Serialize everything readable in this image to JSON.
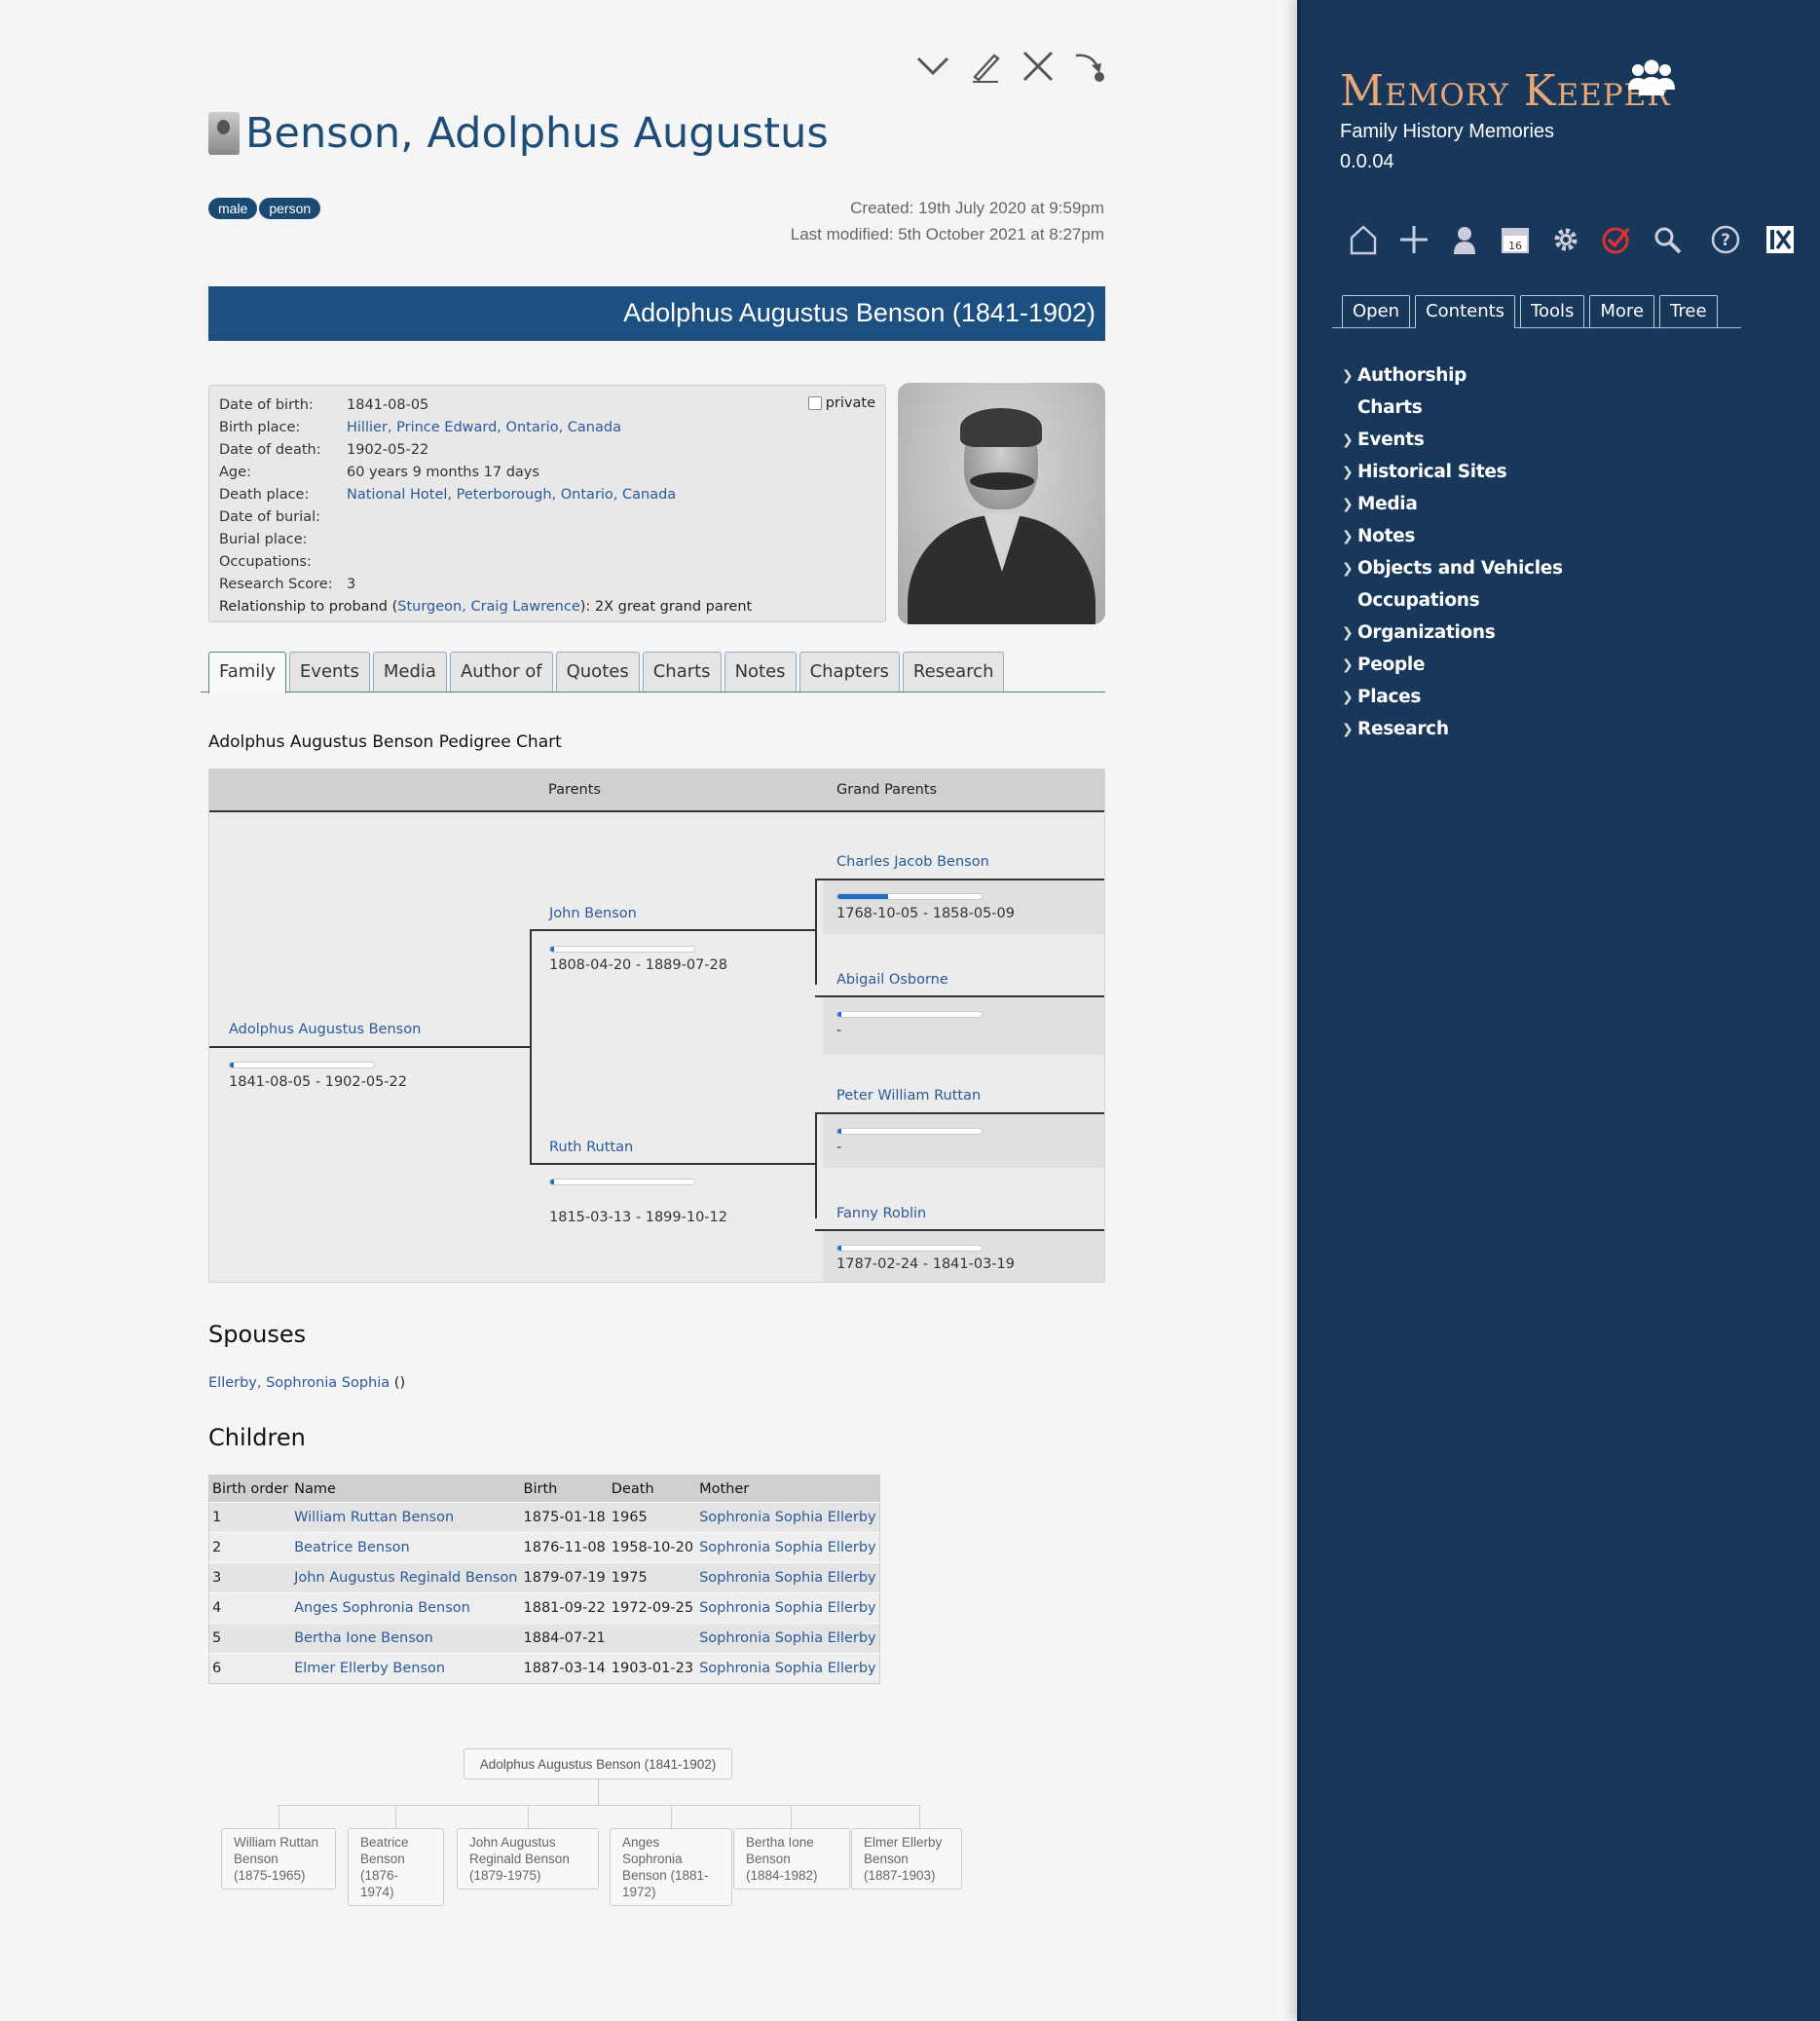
{
  "page": {
    "title": "Benson, Adolphus Augustus",
    "tags": [
      "male",
      "person"
    ],
    "created": "Created: 19th July 2020 at 9:59pm",
    "modified": "Last modified: 5th October 2021 at 8:27pm",
    "banner": "Adolphus Augustus Benson (1841-1902)"
  },
  "toolbar_icons": [
    "chevron-down-icon",
    "edit-icon",
    "close-icon",
    "export-icon"
  ],
  "facts": [
    {
      "label": "Date of birth:",
      "value": "1841-08-05",
      "link": false
    },
    {
      "label": "Birth place:",
      "value": "Hillier, Prince Edward, Ontario, Canada",
      "link": true
    },
    {
      "label": "Date of death:",
      "value": "1902-05-22",
      "link": false
    },
    {
      "label": "Age:",
      "value": "60 years 9 months 17 days",
      "link": false
    },
    {
      "label": "Death place:",
      "value": "National Hotel, Peterborough, Ontario, Canada",
      "link": true
    },
    {
      "label": "Date of burial:",
      "value": "",
      "link": false
    },
    {
      "label": "Burial place:",
      "value": "",
      "link": false
    },
    {
      "label": "Occupations:",
      "value": "",
      "link": false
    },
    {
      "label": "Research Score:",
      "value": "3",
      "link": false
    }
  ],
  "relationship": {
    "prefix": "Relationship to proband (",
    "link": "Sturgeon, Craig Lawrence",
    "suffix": "): 2X great grand parent"
  },
  "private_label": "private",
  "tabs": [
    "Family",
    "Events",
    "Media",
    "Author of",
    "Quotes",
    "Charts",
    "Notes",
    "Chapters",
    "Research"
  ],
  "pedigree": {
    "title": "Adolphus Augustus Benson Pedigree Chart",
    "col_parents": "Parents",
    "col_grandparents": "Grand Parents",
    "self": {
      "name": "Adolphus Augustus Benson",
      "dates": "1841-08-05 - 1902-05-22",
      "score": 0.03
    },
    "father": {
      "name": "John Benson",
      "dates": "1808-04-20 - 1889-07-28",
      "score": 0.03
    },
    "mother": {
      "name": "Ruth Ruttan",
      "dates": "1815-03-13 - 1899-10-12",
      "score": 0.03
    },
    "pgf": {
      "name": "Charles Jacob Benson",
      "dates": "1768-10-05 - 1858-05-09",
      "score": 0.35
    },
    "pgm": {
      "name": "Abigail Osborne",
      "dates": "-",
      "score": 0.03
    },
    "mgf": {
      "name": "Peter William Ruttan",
      "dates": "-",
      "score": 0.03
    },
    "mgm": {
      "name": "Fanny Roblin",
      "dates": "1787-02-24 - 1841-03-19",
      "score": 0.03
    }
  },
  "spouses": {
    "heading": "Spouses",
    "items": [
      {
        "name": "Ellerby, Sophronia Sophia",
        "suffix": " ()"
      }
    ]
  },
  "children": {
    "heading": "Children",
    "columns": [
      "Birth order",
      "Name",
      "Birth",
      "Death",
      "Mother"
    ],
    "rows": [
      [
        "1",
        "William Ruttan Benson",
        "1875-01-18",
        "1965",
        "Sophronia Sophia Ellerby"
      ],
      [
        "2",
        "Beatrice Benson",
        "1876-11-08",
        "1958-10-20",
        "Sophronia Sophia Ellerby"
      ],
      [
        "3",
        "John Augustus Reginald Benson",
        "1879-07-19",
        "1975",
        "Sophronia Sophia Ellerby"
      ],
      [
        "4",
        "Anges Sophronia Benson",
        "1881-09-22",
        "1972-09-25",
        "Sophronia Sophia Ellerby"
      ],
      [
        "5",
        "Bertha Ione Benson",
        "1884-07-21",
        "",
        "Sophronia Sophia Ellerby"
      ],
      [
        "6",
        "Elmer Ellerby Benson",
        "1887-03-14",
        "1903-01-23",
        "Sophronia Sophia Ellerby"
      ]
    ]
  },
  "tree": {
    "root": "Adolphus Augustus Benson (1841-1902)",
    "nodes": [
      [
        "William Ruttan",
        "Benson",
        "(1875-1965)"
      ],
      [
        "Beatrice",
        "Benson",
        "(1876-",
        "1974)"
      ],
      [
        "John Augustus",
        "Reginald Benson",
        "(1879-1975)"
      ],
      [
        "Anges",
        "Sophronia",
        "Benson (1881-",
        "1972)"
      ],
      [
        "Bertha Ione",
        "Benson",
        "(1884-1982)"
      ],
      [
        "Elmer Ellerby",
        "Benson",
        "(1887-1903)"
      ]
    ]
  },
  "sidebar": {
    "brand": "Memory Keeper",
    "subtitle": "Family History Memories",
    "version": "0.0.04",
    "icons": [
      "home-icon",
      "add-icon",
      "person-icon",
      "calendar-icon",
      "gear-icon",
      "check-icon",
      "search-icon",
      "help-icon",
      "close-panel-icon"
    ],
    "calendar_day": "16",
    "tabs": [
      "Open",
      "Contents",
      "Tools",
      "More",
      "Tree"
    ],
    "active_tab": "Contents",
    "menu": [
      {
        "label": "Authorship",
        "expandable": true
      },
      {
        "label": "Charts",
        "expandable": false
      },
      {
        "label": "Events",
        "expandable": true
      },
      {
        "label": "Historical Sites",
        "expandable": true
      },
      {
        "label": "Media",
        "expandable": true
      },
      {
        "label": "Notes",
        "expandable": true
      },
      {
        "label": "Objects and Vehicles",
        "expandable": true
      },
      {
        "label": "Occupations",
        "expandable": false
      },
      {
        "label": "Organizations",
        "expandable": true
      },
      {
        "label": "People",
        "expandable": true
      },
      {
        "label": "Places",
        "expandable": true
      },
      {
        "label": "Research",
        "expandable": true
      }
    ]
  },
  "colors": {
    "accent": "#1c5080",
    "sidebar": "#17375b",
    "brand": "#e8a878",
    "link": "#2a5a9a"
  }
}
